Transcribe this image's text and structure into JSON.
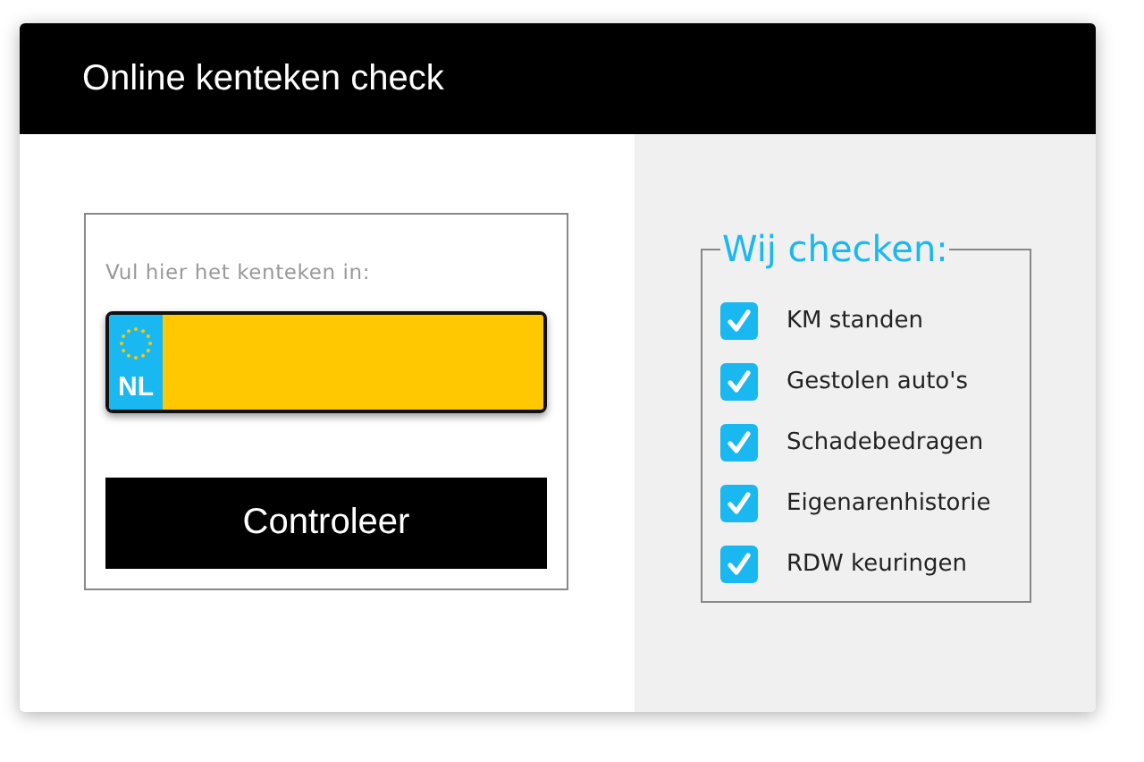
{
  "header": {
    "title": "Online kenteken check"
  },
  "form": {
    "label": "Vul hier het kenteken in:",
    "plate": {
      "country": "NL"
    },
    "button": "Controleer"
  },
  "checks": {
    "title": "Wij checken:",
    "items": [
      {
        "label": "KM standen",
        "checked": true
      },
      {
        "label": "Gestolen auto's",
        "checked": true
      },
      {
        "label": "Schadebedragen",
        "checked": true
      },
      {
        "label": "Eigenarenhistorie",
        "checked": true
      },
      {
        "label": "RDW keuringen",
        "checked": true
      }
    ]
  }
}
